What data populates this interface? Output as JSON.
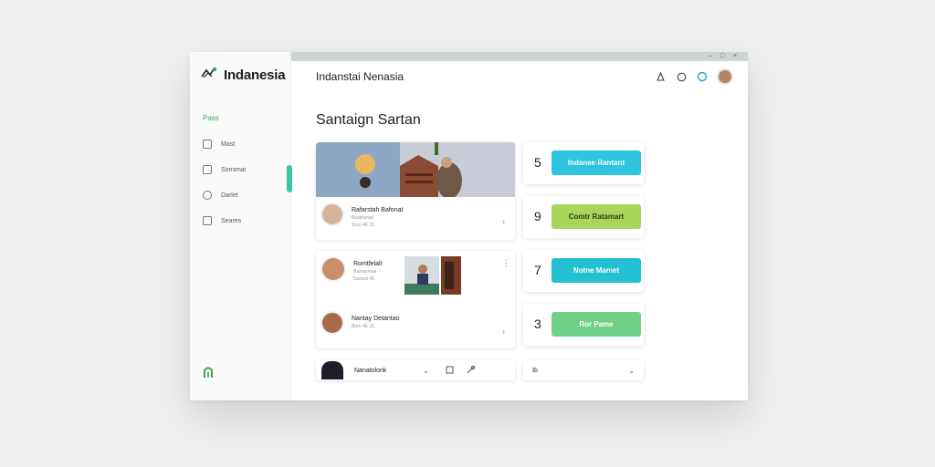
{
  "app": {
    "name": "Indanesia"
  },
  "window": {
    "controls": [
      "–",
      "□",
      "×"
    ]
  },
  "sidebar": {
    "active_label": "Pass",
    "items": [
      {
        "label": "Mast",
        "icon": "square-icon"
      },
      {
        "label": "Sonsmai",
        "icon": "list-icon"
      },
      {
        "label": "Darlet",
        "icon": "chat-icon"
      },
      {
        "label": "Seares",
        "icon": "add-icon"
      }
    ]
  },
  "header": {
    "title": "Indanstai Nenasia",
    "icons": [
      "bell-icon",
      "chat-icon",
      "sync-icon",
      "avatar"
    ]
  },
  "main": {
    "title": "Santaign Sartan",
    "feed": [
      {
        "name": "Rafarstah Bafonat",
        "sub": "Bsabranad",
        "time": "Sroo 4E 15"
      },
      {
        "name": "Romtfelalt",
        "sub": "Basraoioaa",
        "time": "Sasred 4E"
      },
      {
        "name": "Nantay Detantao",
        "sub": "Bore 4E 15"
      }
    ],
    "stats": [
      {
        "num": "5",
        "label": "Indanee Rantant",
        "color": "#2ec4df"
      },
      {
        "num": "9",
        "label": "Comtr Ratamart",
        "color": "#a8d65a"
      },
      {
        "num": "7",
        "label": "Notne Mamet",
        "color": "#22c0d1"
      },
      {
        "num": "3",
        "label": "Ror Pame",
        "color": "#70d085"
      }
    ],
    "bottom_left": {
      "label": "Nanatolonk"
    },
    "bottom_right": {
      "label": "Ib"
    }
  }
}
